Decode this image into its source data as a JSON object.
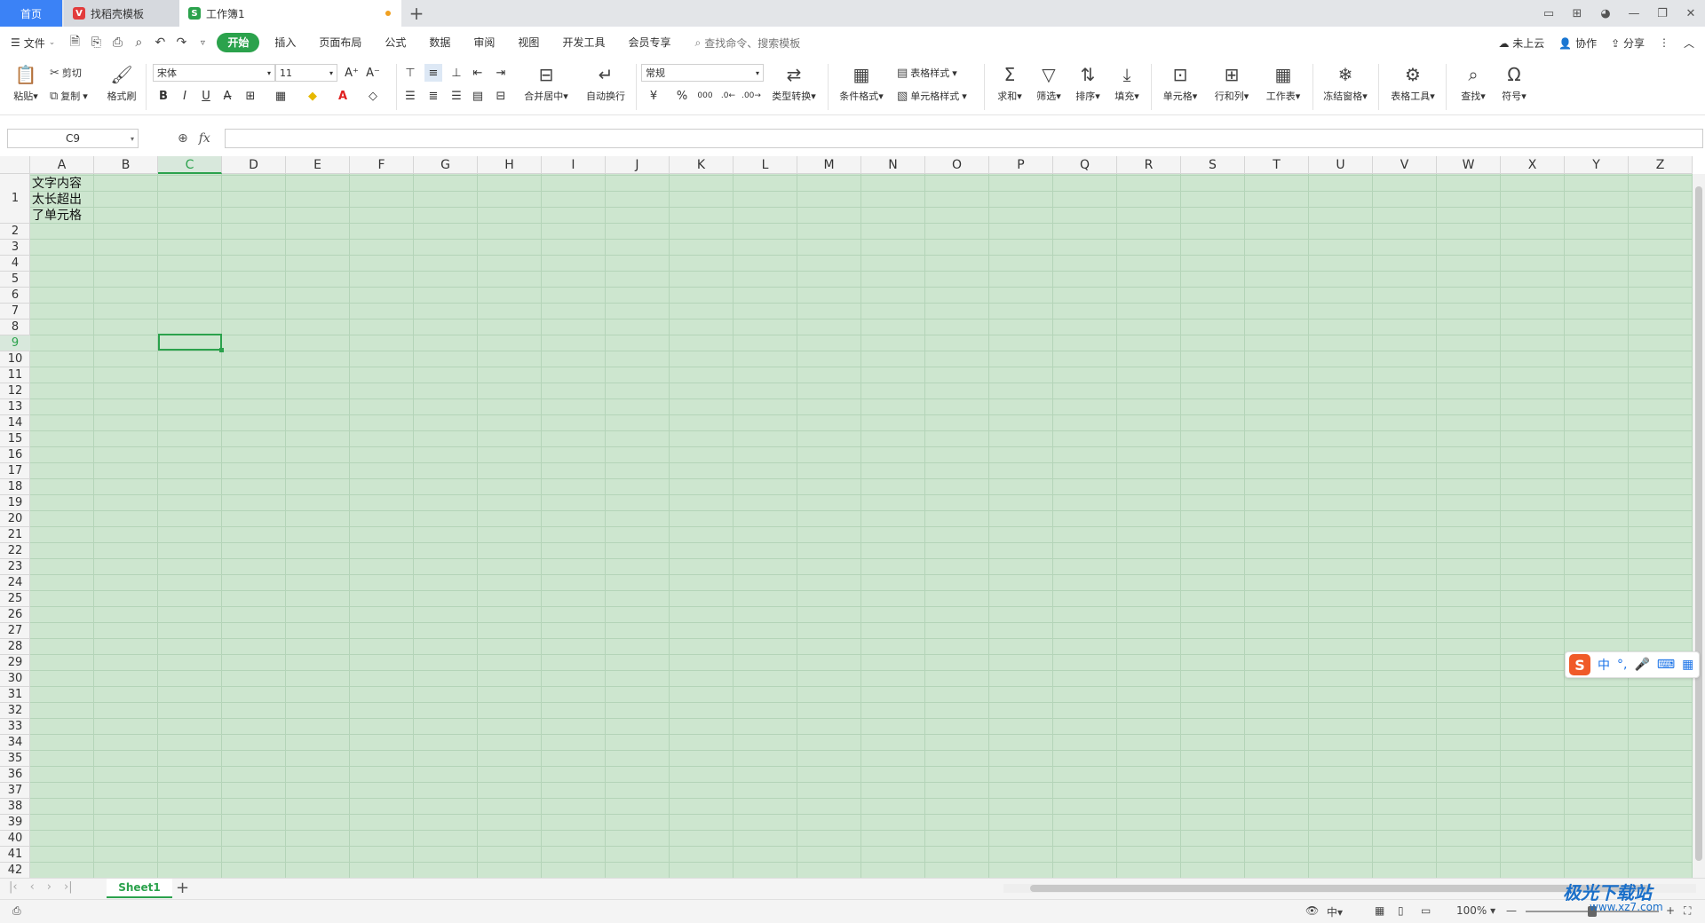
{
  "tabs": {
    "home": "首页",
    "template": "找稻壳模板",
    "document": "工作簿1"
  },
  "menu": {
    "file": "文件",
    "tabs": [
      "开始",
      "插入",
      "页面布局",
      "公式",
      "数据",
      "审阅",
      "视图",
      "开发工具",
      "会员专享"
    ],
    "search_placeholder": "查找命令、搜索模板",
    "cloud": "未上云",
    "collab": "协作",
    "share": "分享"
  },
  "ribbon": {
    "paste": "粘贴",
    "cut": "剪切",
    "copy": "复制",
    "format_painter": "格式刷",
    "font_name": "宋体",
    "font_size": "11",
    "merge_center": "合并居中",
    "wrap_text": "自动换行",
    "number_format": "常规",
    "type_convert": "类型转换",
    "cond_format": "条件格式",
    "table_style": "表格样式",
    "cell_style": "单元格样式",
    "sum": "求和",
    "filter": "筛选",
    "sort": "排序",
    "fill": "填充",
    "cell": "单元格",
    "row_col": "行和列",
    "worksheet": "工作表",
    "freeze": "冻结窗格",
    "table_tools": "表格工具",
    "find": "查找",
    "symbol": "符号"
  },
  "formula_bar": {
    "name_box": "C9",
    "fx": "fx",
    "value": ""
  },
  "grid": {
    "columns": [
      "A",
      "B",
      "C",
      "D",
      "E",
      "F",
      "G",
      "H",
      "I",
      "J",
      "K",
      "L",
      "M",
      "N",
      "O",
      "P",
      "Q",
      "R",
      "S",
      "T",
      "U",
      "V",
      "W",
      "X",
      "Y",
      "Z"
    ],
    "selected_column": "C",
    "selected_row": 9,
    "row_count": 42,
    "cell_a1": "文字内容太长超出了单元格"
  },
  "ime": {
    "mode": "中",
    "punct": "°,"
  },
  "sheets": {
    "active": "Sheet1"
  },
  "status": {
    "input_mode": "中",
    "zoom": "100%"
  },
  "watermark": {
    "brand": "极光下载站",
    "url": "www.xz7.com"
  },
  "colors": {
    "accent": "#2ba24c",
    "cell_bg": "#cde6cf",
    "home_tab": "#3b82f6"
  }
}
